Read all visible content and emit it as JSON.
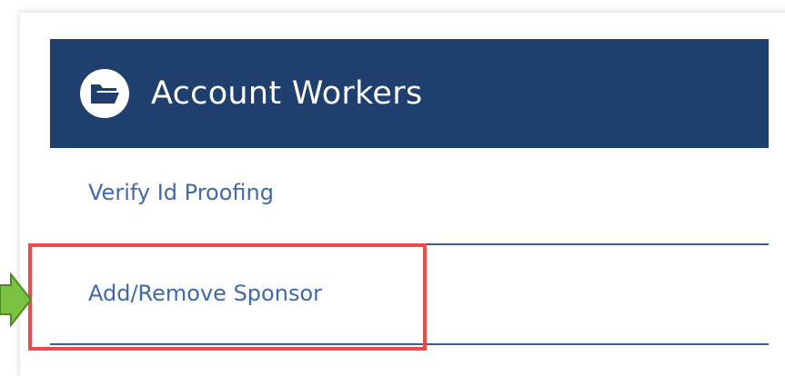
{
  "panel": {
    "title": "Account Workers",
    "header_icon": "folder-open-icon",
    "header_color": "#1f3f6e"
  },
  "menu": {
    "items": [
      {
        "label": "Verify Id Proofing"
      },
      {
        "label": "Add/Remove Sponsor",
        "highlighted": true
      }
    ],
    "link_color": "#3f6aa7"
  },
  "annotations": {
    "highlight_color": "#ef4a4a",
    "pointer_arrow": "green-arrow-icon",
    "pointer_color": "#7cc242"
  }
}
